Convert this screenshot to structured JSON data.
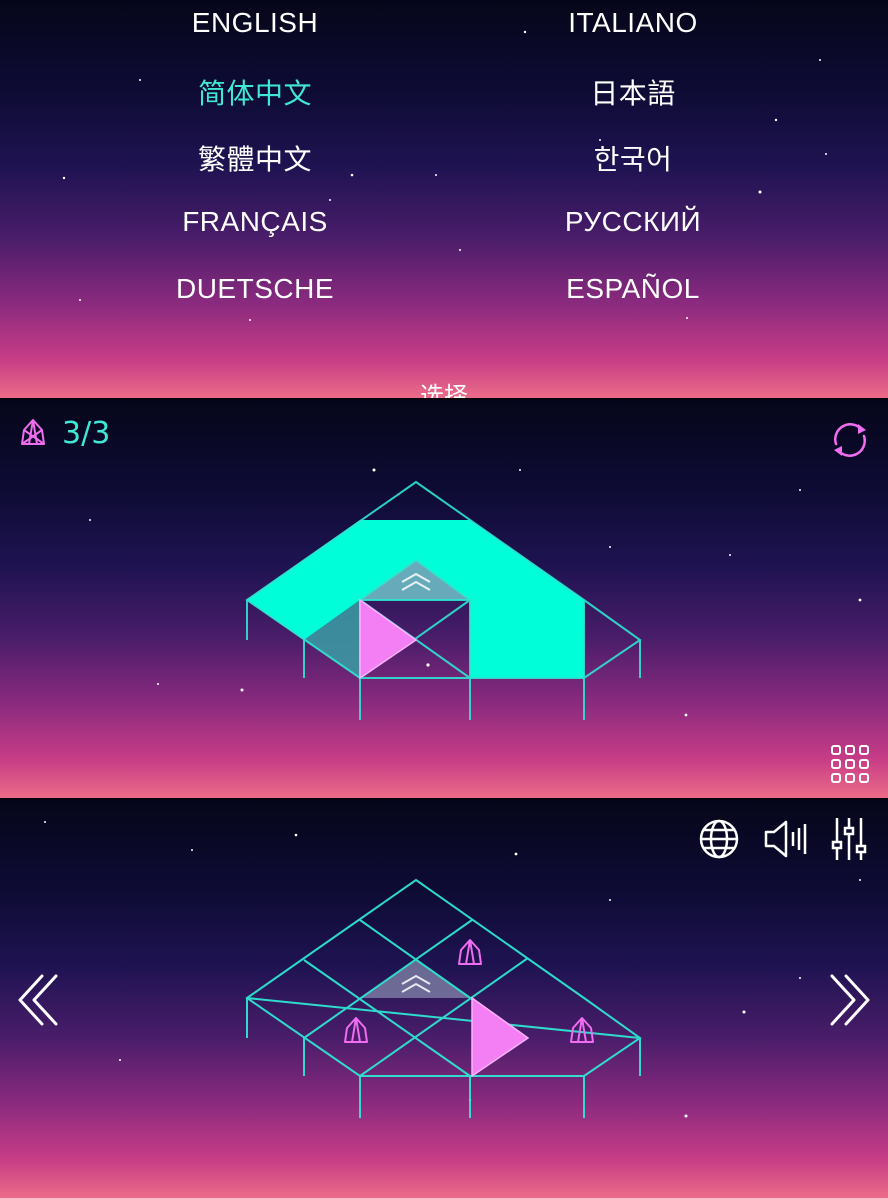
{
  "language_menu": {
    "languages": [
      {
        "label": "ENGLISH",
        "active": false
      },
      {
        "label": "ITALIANO",
        "active": false
      },
      {
        "label": "简体中文",
        "active": true
      },
      {
        "label": "日本語",
        "active": false
      },
      {
        "label": "繁體中文",
        "active": false
      },
      {
        "label": "한국어",
        "active": false
      },
      {
        "label": "FRANÇAIS",
        "active": false
      },
      {
        "label": "РУССКИЙ",
        "active": false
      },
      {
        "label": "DUETSCHE",
        "active": false
      },
      {
        "label": "ESPAÑOL",
        "active": false
      }
    ],
    "select_label": "选择"
  },
  "level_screen": {
    "counter": "3/3",
    "icons": [
      "gem-icon",
      "restart-icon",
      "level-grid-icon"
    ]
  },
  "home_screen": {
    "icons": [
      "globe-icon",
      "sound-icon",
      "settings-sliders-icon",
      "chevron-left-icon",
      "chevron-right-icon"
    ]
  },
  "colors": {
    "accent_cyan": "#3ee8d4",
    "fill_cyan": "#00ffd9",
    "accent_pink": "#f06cf0",
    "grid_line": "#2ee6d2",
    "gradient_bottom": "#ec6b88"
  }
}
